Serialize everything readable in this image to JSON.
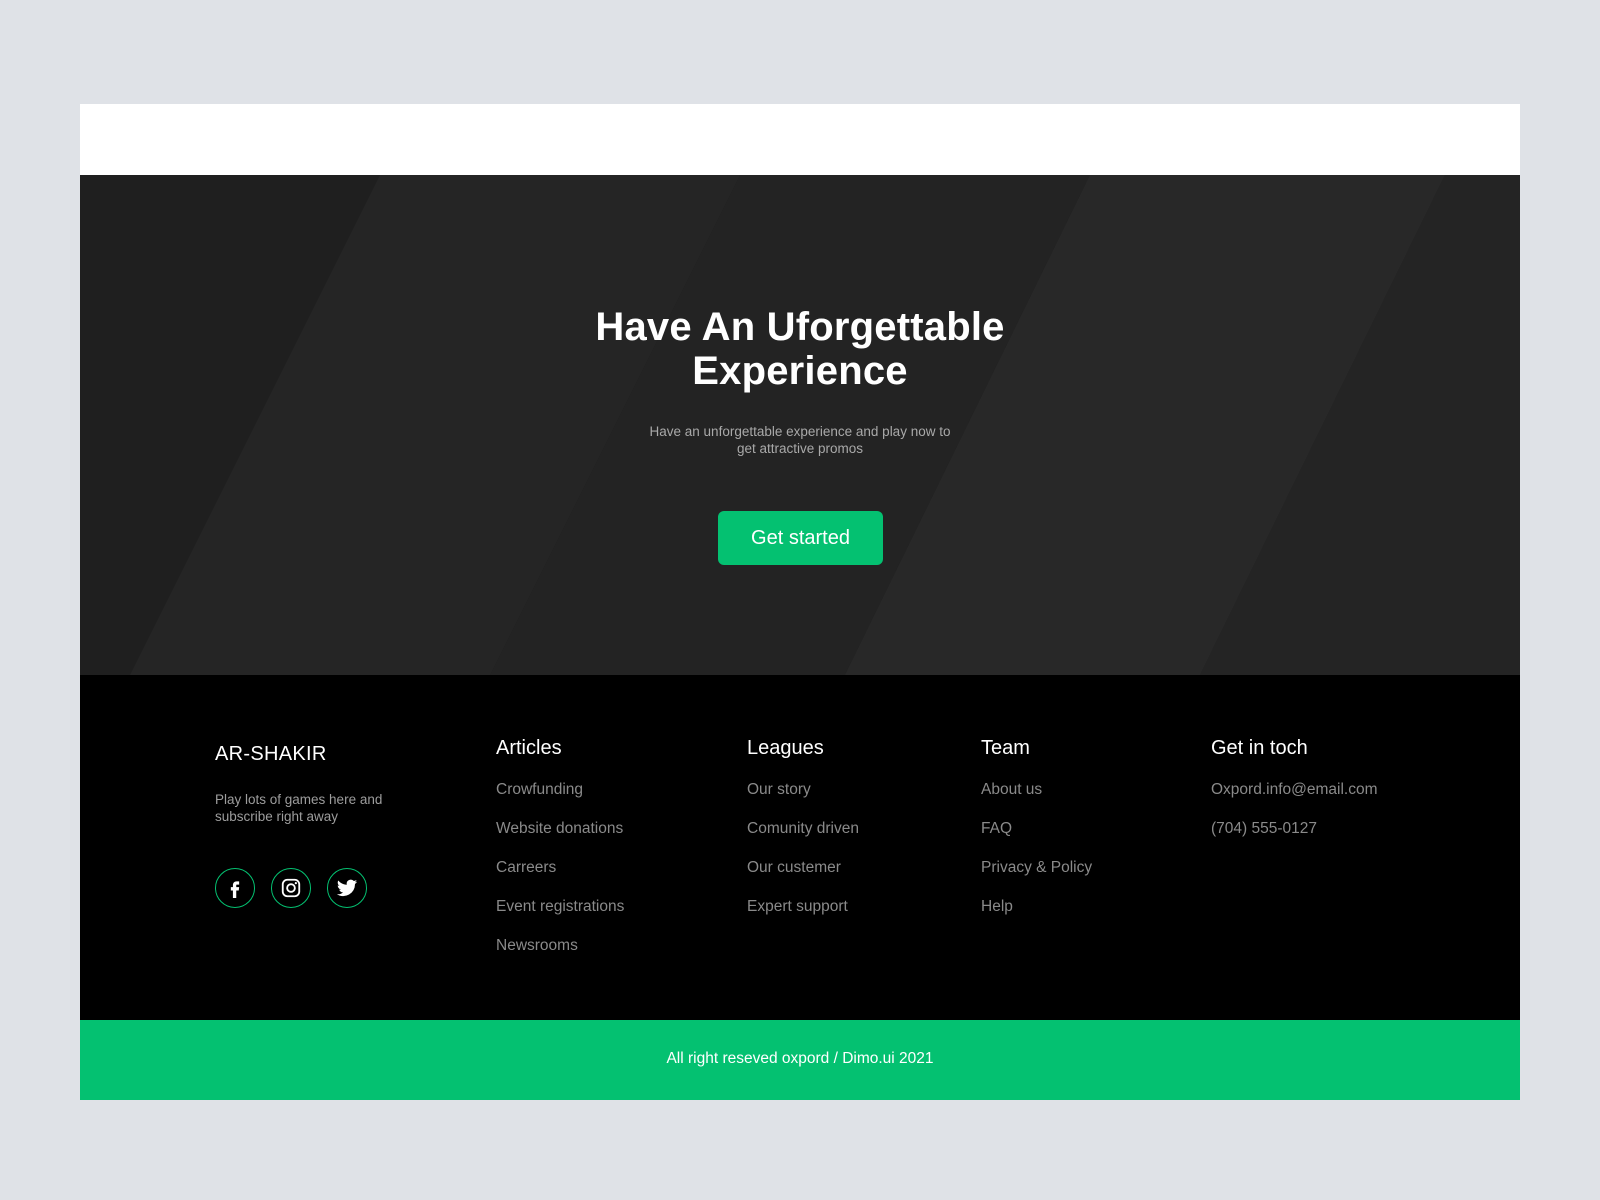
{
  "colors": {
    "accent": "#04c171",
    "hero_bg": "#232323",
    "hero_band": "#282828",
    "footer_bg": "#000000",
    "page_bg": "#dfe2e7"
  },
  "hero": {
    "title_line1": "Have An Uforgettable",
    "title_line2": "Experience",
    "subtitle_line1": "Have an unforgettable experience and play now to",
    "subtitle_line2": "get attractive promos",
    "cta_label": "Get started"
  },
  "footer": {
    "brand": "AR-SHAKIR",
    "brand_desc_line1": "Play lots of games here and",
    "brand_desc_line2": "subscribe right away",
    "socials": [
      {
        "icon": "facebook-icon"
      },
      {
        "icon": "instagram-icon"
      },
      {
        "icon": "twitter-icon"
      }
    ],
    "columns": [
      {
        "title": "Articles",
        "links": [
          "Crowfunding",
          "Website donations",
          "Carreers",
          "Event registrations",
          "Newsrooms"
        ]
      },
      {
        "title": "Leagues",
        "links": [
          "Our story",
          "Comunity driven",
          "Our custemer",
          "Expert support"
        ]
      },
      {
        "title": "Team",
        "links": [
          "About us",
          "FAQ",
          "Privacy & Policy",
          "Help"
        ]
      },
      {
        "title": "Get in toch",
        "links": [
          "Oxpord.info@email.com",
          "(704) 555-0127"
        ]
      }
    ]
  },
  "copyright": "All right reseved oxpord / Dimo.ui 2021"
}
